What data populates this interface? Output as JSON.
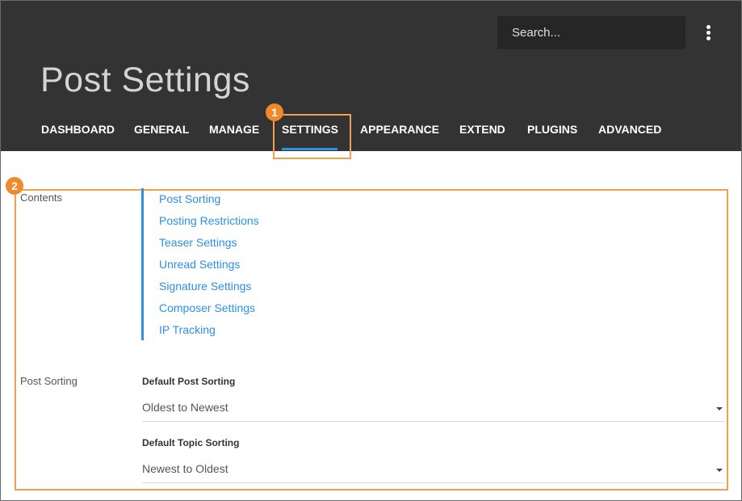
{
  "header": {
    "search_placeholder": "Search...",
    "menu_icon": "more-vertical-icon",
    "page_title": "Post Settings",
    "tabs": [
      {
        "label": "DASHBOARD"
      },
      {
        "label": "GENERAL"
      },
      {
        "label": "MANAGE"
      },
      {
        "label": "SETTINGS",
        "active": true
      },
      {
        "label": "APPEARANCE"
      },
      {
        "label": "EXTEND"
      },
      {
        "label": "PLUGINS"
      },
      {
        "label": "ADVANCED"
      }
    ]
  },
  "annotations": {
    "badge_1": "1",
    "badge_2": "2",
    "color": "#ef8a2a"
  },
  "contents": {
    "label": "Contents",
    "links": [
      "Post Sorting",
      "Posting Restrictions",
      "Teaser Settings",
      "Unread Settings",
      "Signature Settings",
      "Composer Settings",
      "IP Tracking"
    ]
  },
  "post_sorting": {
    "label": "Post Sorting",
    "default_post_sorting_label": "Default Post Sorting",
    "default_post_sorting_value": "Oldest to Newest",
    "default_topic_sorting_label": "Default Topic Sorting",
    "default_topic_sorting_value": "Newest to Oldest"
  },
  "colors": {
    "header_bg": "#333333",
    "accent": "#2c8fe8"
  }
}
